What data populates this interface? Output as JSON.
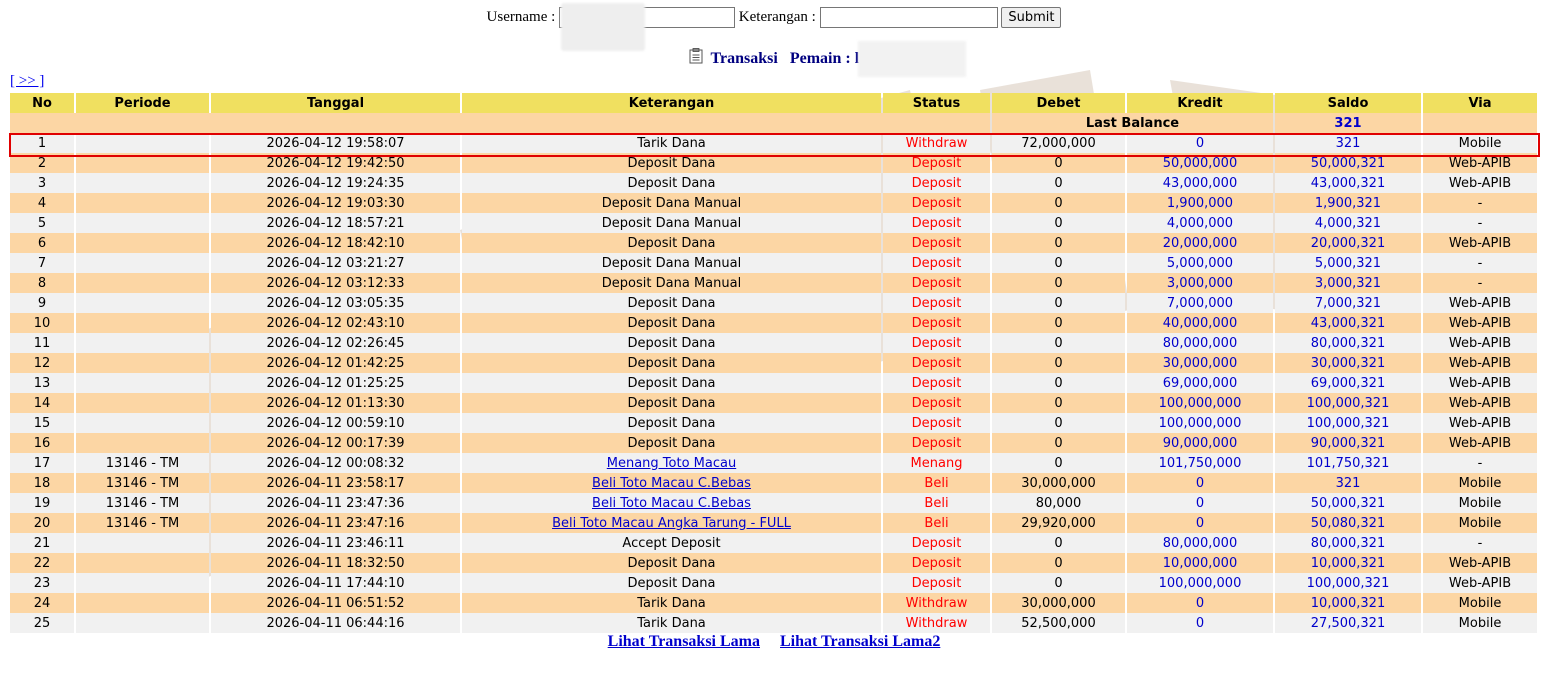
{
  "search": {
    "username_label": "Username :",
    "username_value": "",
    "keterangan_label": "Keterangan :",
    "keterangan_value": "",
    "submit_label": "Submit"
  },
  "title": {
    "transaksi": "Transaksi",
    "pemain_label": "Pemain : l"
  },
  "nav": {
    "next": "[ >> ]"
  },
  "table": {
    "headers": [
      "No",
      "Periode",
      "Tanggal",
      "Keterangan",
      "Status",
      "Debet",
      "Kredit",
      "Saldo",
      "Via"
    ],
    "last_balance_label": "Last Balance",
    "last_balance_value": "321",
    "rows": [
      {
        "no": "1",
        "periode": "",
        "tanggal": "2026-04-12 19:58:07",
        "keterangan": "Tarik Dana",
        "status": "Withdraw",
        "debet": "72,000,000",
        "kredit": "0",
        "saldo": "321",
        "via": "Mobile"
      },
      {
        "no": "2",
        "periode": "",
        "tanggal": "2026-04-12 19:42:50",
        "keterangan": "Deposit Dana",
        "status": "Deposit",
        "debet": "0",
        "kredit": "50,000,000",
        "saldo": "50,000,321",
        "via": "Web-APIB"
      },
      {
        "no": "3",
        "periode": "",
        "tanggal": "2026-04-12 19:24:35",
        "keterangan": "Deposit Dana",
        "status": "Deposit",
        "debet": "0",
        "kredit": "43,000,000",
        "saldo": "43,000,321",
        "via": "Web-APIB"
      },
      {
        "no": "4",
        "periode": "",
        "tanggal": "2026-04-12 19:03:30",
        "keterangan": "Deposit Dana Manual",
        "status": "Deposit",
        "debet": "0",
        "kredit": "1,900,000",
        "saldo": "1,900,321",
        "via": "-"
      },
      {
        "no": "5",
        "periode": "",
        "tanggal": "2026-04-12 18:57:21",
        "keterangan": "Deposit Dana Manual",
        "status": "Deposit",
        "debet": "0",
        "kredit": "4,000,000",
        "saldo": "4,000,321",
        "via": "-"
      },
      {
        "no": "6",
        "periode": "",
        "tanggal": "2026-04-12 18:42:10",
        "keterangan": "Deposit Dana",
        "status": "Deposit",
        "debet": "0",
        "kredit": "20,000,000",
        "saldo": "20,000,321",
        "via": "Web-APIB"
      },
      {
        "no": "7",
        "periode": "",
        "tanggal": "2026-04-12 03:21:27",
        "keterangan": "Deposit Dana Manual",
        "status": "Deposit",
        "debet": "0",
        "kredit": "5,000,000",
        "saldo": "5,000,321",
        "via": "-"
      },
      {
        "no": "8",
        "periode": "",
        "tanggal": "2026-04-12 03:12:33",
        "keterangan": "Deposit Dana Manual",
        "status": "Deposit",
        "debet": "0",
        "kredit": "3,000,000",
        "saldo": "3,000,321",
        "via": "-"
      },
      {
        "no": "9",
        "periode": "",
        "tanggal": "2026-04-12 03:05:35",
        "keterangan": "Deposit Dana",
        "status": "Deposit",
        "debet": "0",
        "kredit": "7,000,000",
        "saldo": "7,000,321",
        "via": "Web-APIB"
      },
      {
        "no": "10",
        "periode": "",
        "tanggal": "2026-04-12 02:43:10",
        "keterangan": "Deposit Dana",
        "status": "Deposit",
        "debet": "0",
        "kredit": "40,000,000",
        "saldo": "43,000,321",
        "via": "Web-APIB"
      },
      {
        "no": "11",
        "periode": "",
        "tanggal": "2026-04-12 02:26:45",
        "keterangan": "Deposit Dana",
        "status": "Deposit",
        "debet": "0",
        "kredit": "80,000,000",
        "saldo": "80,000,321",
        "via": "Web-APIB"
      },
      {
        "no": "12",
        "periode": "",
        "tanggal": "2026-04-12 01:42:25",
        "keterangan": "Deposit Dana",
        "status": "Deposit",
        "debet": "0",
        "kredit": "30,000,000",
        "saldo": "30,000,321",
        "via": "Web-APIB"
      },
      {
        "no": "13",
        "periode": "",
        "tanggal": "2026-04-12 01:25:25",
        "keterangan": "Deposit Dana",
        "status": "Deposit",
        "debet": "0",
        "kredit": "69,000,000",
        "saldo": "69,000,321",
        "via": "Web-APIB"
      },
      {
        "no": "14",
        "periode": "",
        "tanggal": "2026-04-12 01:13:30",
        "keterangan": "Deposit Dana",
        "status": "Deposit",
        "debet": "0",
        "kredit": "100,000,000",
        "saldo": "100,000,321",
        "via": "Web-APIB"
      },
      {
        "no": "15",
        "periode": "",
        "tanggal": "2026-04-12 00:59:10",
        "keterangan": "Deposit Dana",
        "status": "Deposit",
        "debet": "0",
        "kredit": "100,000,000",
        "saldo": "100,000,321",
        "via": "Web-APIB"
      },
      {
        "no": "16",
        "periode": "",
        "tanggal": "2026-04-12 00:17:39",
        "keterangan": "Deposit Dana",
        "status": "Deposit",
        "debet": "0",
        "kredit": "90,000,000",
        "saldo": "90,000,321",
        "via": "Web-APIB"
      },
      {
        "no": "17",
        "periode": "13146 - TM",
        "tanggal": "2026-04-12 00:08:32",
        "keterangan": "Menang Toto Macau",
        "link": true,
        "status": "Menang",
        "debet": "0",
        "kredit": "101,750,000",
        "saldo": "101,750,321",
        "via": "-"
      },
      {
        "no": "18",
        "periode": "13146 - TM",
        "tanggal": "2026-04-11 23:58:17",
        "keterangan": "Beli Toto Macau C.Bebas",
        "link": true,
        "status": "Beli",
        "debet": "30,000,000",
        "kredit": "0",
        "saldo": "321",
        "via": "Mobile"
      },
      {
        "no": "19",
        "periode": "13146 - TM",
        "tanggal": "2026-04-11 23:47:36",
        "keterangan": "Beli Toto Macau C.Bebas",
        "link": true,
        "status": "Beli",
        "debet": "80,000",
        "kredit": "0",
        "saldo": "50,000,321",
        "via": "Mobile"
      },
      {
        "no": "20",
        "periode": "13146 - TM",
        "tanggal": "2026-04-11 23:47:16",
        "keterangan": "Beli Toto Macau Angka Tarung - FULL",
        "link": true,
        "status": "Beli",
        "debet": "29,920,000",
        "kredit": "0",
        "saldo": "50,080,321",
        "via": "Mobile"
      },
      {
        "no": "21",
        "periode": "",
        "tanggal": "2026-04-11 23:46:11",
        "keterangan": "Accept Deposit",
        "status": "Deposit",
        "debet": "0",
        "kredit": "80,000,000",
        "saldo": "80,000,321",
        "via": "-"
      },
      {
        "no": "22",
        "periode": "",
        "tanggal": "2026-04-11 18:32:50",
        "keterangan": "Deposit Dana",
        "status": "Deposit",
        "debet": "0",
        "kredit": "10,000,000",
        "saldo": "10,000,321",
        "via": "Web-APIB"
      },
      {
        "no": "23",
        "periode": "",
        "tanggal": "2026-04-11 17:44:10",
        "keterangan": "Deposit Dana",
        "status": "Deposit",
        "debet": "0",
        "kredit": "100,000,000",
        "saldo": "100,000,321",
        "via": "Web-APIB"
      },
      {
        "no": "24",
        "periode": "",
        "tanggal": "2026-04-11 06:51:52",
        "keterangan": "Tarik Dana",
        "status": "Withdraw",
        "debet": "30,000,000",
        "kredit": "0",
        "saldo": "10,000,321",
        "via": "Mobile"
      },
      {
        "no": "25",
        "periode": "",
        "tanggal": "2026-04-11 06:44:16",
        "keterangan": "Tarik Dana",
        "status": "Withdraw",
        "debet": "52,500,000",
        "kredit": "0",
        "saldo": "27,500,321",
        "via": "Mobile"
      }
    ]
  },
  "footer": {
    "link1": "Lihat Transaksi Lama",
    "link2": "Lihat Transaksi Lama2"
  },
  "colors": {
    "header_bg": "#f0e060",
    "row_odd": "#f1f1f1",
    "row_even": "#fcd6a4",
    "status_red": "#ff0000",
    "amount_blue": "#0000cc",
    "highlight_border": "#e00000"
  }
}
